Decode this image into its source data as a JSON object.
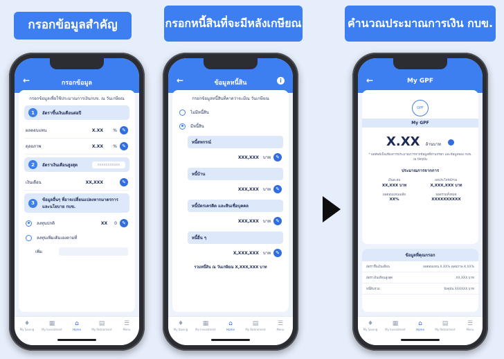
{
  "steps": {
    "step1": "กรอกข้อมูลสำคัญ",
    "step2_line1": "กรอกหนี้สิน",
    "step2_line2": "ที่จะมีหลังเกษียณ",
    "step3_line1": "คำนวณ",
    "step3_line2": "ประมาณการเงิน กบข."
  },
  "phone1": {
    "title": "กรอกข้อมูล",
    "intro": "กรอกข้อมูลเพื่อใช้ประมาณการเงินกบข. ณ วันเกษียณ",
    "section1": "อัตราขึ้นเงินเดือนต่อปี",
    "rows1": [
      {
        "label": "ผลตอบแทน",
        "value": "X.XX",
        "unit": "%"
      },
      {
        "label": "ดุลยภาพ",
        "value": "X.XX",
        "unit": "%"
      }
    ],
    "section2": "อัตราเงินเดือนสูงสุด",
    "section2_input": "xxxxxxxxxxx",
    "row2": {
      "label": "เงินเดือน",
      "value": "XX,XXX"
    },
    "section3": "ข้อมูลอื่นๆ ที่อาจเปลี่ยนแปลงหากมาตรการ และนโยบาย กบข.",
    "radio1": {
      "label": "ลงทุนปกติ",
      "value": "XX",
      "unit": "0"
    },
    "radio2": {
      "label": "ลงทุนเพิ่มเติมเองตามที่"
    },
    "sub_label": "เพิ่ม"
  },
  "phone2": {
    "title": "ข้อมูลหนี้สิน",
    "intro": "กรอกข้อมูลหนี้สินที่คาดว่าจะมีณ วันเกษียณ",
    "radio_none": "ไม่มีหนี้สิน",
    "radio_has": "มีหนี้สิน",
    "debts": [
      {
        "label": "หนี้สหกรณ์",
        "value": "XXX,XXX",
        "unit": "บาท"
      },
      {
        "label": "หนี้บ้าน",
        "value": "XXX,XXX",
        "unit": "บาท"
      },
      {
        "label": "หนี้บัตรเครดิต และสินเชื่อบุคคล",
        "value": "XXX,XXX",
        "unit": "บาท"
      },
      {
        "label": "หนี้อื่น ๆ",
        "value": "X,XXX,XXX",
        "unit": "บาท"
      }
    ],
    "total": "รวมหนี้สิน ณ วันเกษียณ X,XXX,XXX บาท"
  },
  "phone3": {
    "title": "My GPF",
    "icon_label": "GPF",
    "mygpf": "My GPF",
    "amount": "X.XX",
    "amount_unit": "ล้านบาท",
    "note": "* ผลลัพธ์เป็นเพียงการประมาณการจากข้อมูลที่ท่านกรอก และข้อมูลของ กบข. ณ ปัจจุบัน",
    "est_title": "ประมาณการจากการ",
    "cells": [
      {
        "label": "เงินสะสม",
        "value": "XX,XXX บาท"
      },
      {
        "label": "ผลประโยชน์รวม",
        "value": "X,XXX,XXX บาท"
      },
      {
        "label": "ผลตอบแทนเฉลี่ย",
        "value": "XX%"
      },
      {
        "label": "ยอดรวมทั้งหมด",
        "value": "XXXXXXXXXX"
      }
    ],
    "info_title": "ข้อมูลที่คุณกรอก",
    "info_rows": [
      {
        "k": "อัตราขึ้นเงินเดือน",
        "v": "ผลตอบแทน X.XX% ดุลยภาพ X.XX%"
      },
      {
        "k": "อัตราเงินเดือนสูงสุด",
        "v": "XX,XXX บาท"
      },
      {
        "k": "หนี้สินรวม",
        "v": "ปัจจุบัน XXXXXX บาท"
      }
    ]
  },
  "tabs": [
    "My Saving",
    "My Investment",
    "Home",
    "My Retirement",
    "Menu"
  ]
}
